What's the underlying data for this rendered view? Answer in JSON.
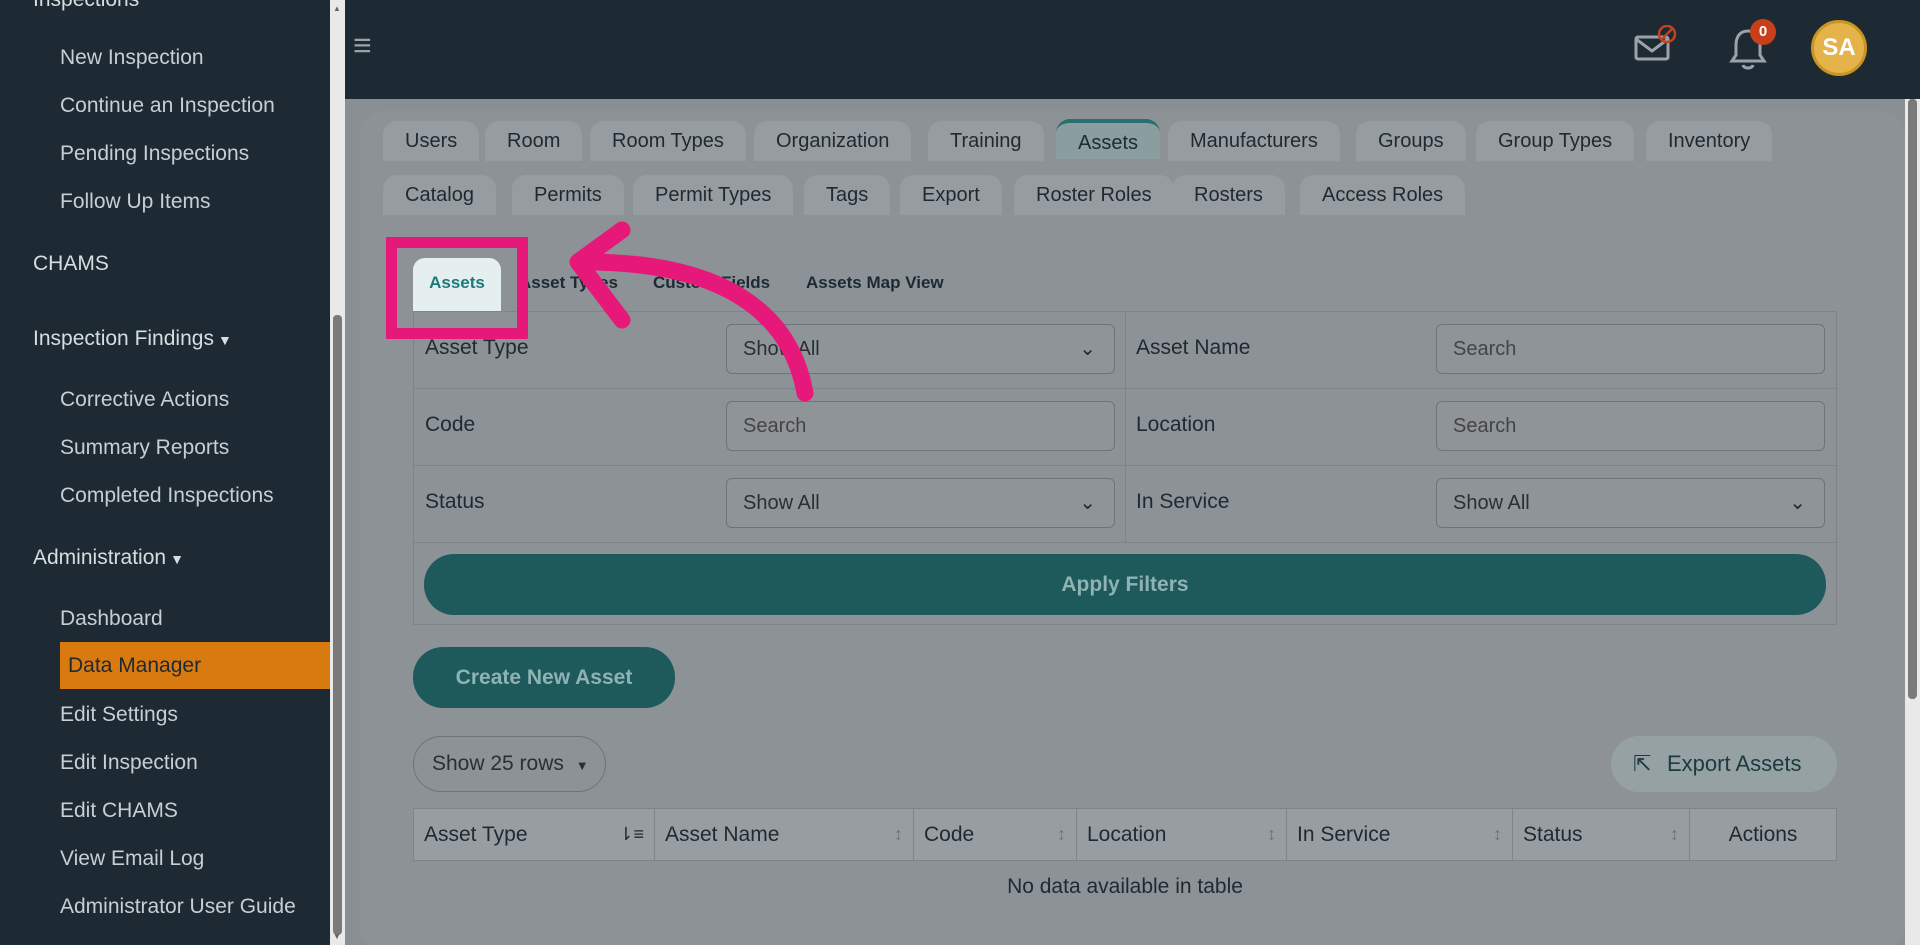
{
  "sidebar": {
    "top_section": "Inspections",
    "inspections_items": [
      "New Inspection",
      "Continue an Inspection",
      "Pending Inspections",
      "Follow Up Items"
    ],
    "chams": "CHAMS",
    "findings_label": "Inspection Findings",
    "findings_items": [
      "Corrective Actions",
      "Summary Reports",
      "Completed Inspections"
    ],
    "admin_label": "Administration",
    "admin_items": [
      "Dashboard",
      "Data Manager",
      "Edit Settings",
      "Edit Inspection",
      "Edit CHAMS",
      "View Email Log",
      "Administrator User Guide"
    ],
    "active_item": "Data Manager",
    "active_color": "#d97a10"
  },
  "header": {
    "notification_count": "0",
    "avatar_initials": "SA"
  },
  "main_tabs_row1": [
    "Users",
    "Room",
    "Room Types",
    "Organization",
    "Training",
    "Assets",
    "Manufacturers",
    "Groups",
    "Group Types",
    "Inventory"
  ],
  "main_tabs_row2": [
    "Catalog",
    "Permits",
    "Permit Types",
    "Tags",
    "Export",
    "Roster Roles",
    "Rosters",
    "Access Roles"
  ],
  "active_main_tab": "Assets",
  "sub_tabs": [
    "Assets",
    "Asset Types",
    "Custom Fields",
    "Assets Map View"
  ],
  "active_sub_tab": "Assets",
  "filters": {
    "asset_type_label": "Asset Type",
    "asset_type_value": "Show All",
    "asset_name_label": "Asset Name",
    "asset_name_placeholder": "Search",
    "code_label": "Code",
    "code_placeholder": "Search",
    "location_label": "Location",
    "location_placeholder": "Search",
    "status_label": "Status",
    "status_value": "Show All",
    "in_service_label": "In Service",
    "in_service_value": "Show All",
    "apply_label": "Apply Filters"
  },
  "create_label": "Create New Asset",
  "rows_label": "Show 25 rows",
  "export_label": "Export Assets",
  "table": {
    "columns": [
      "Asset Type",
      "Asset Name",
      "Code",
      "Location",
      "In Service",
      "Status",
      "Actions"
    ],
    "empty_message": "No data available in table"
  },
  "colors": {
    "accent": "#1e5a5c",
    "highlight": "#e6197a"
  }
}
